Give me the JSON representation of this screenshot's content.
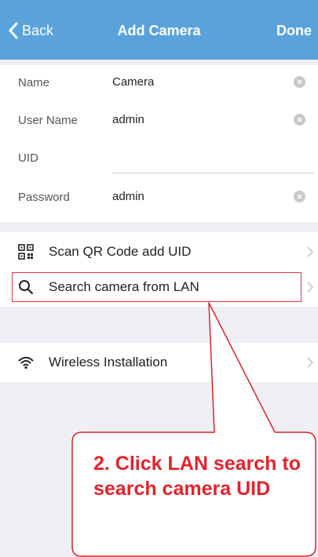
{
  "navbar": {
    "back_label": "Back",
    "title": "Add Camera",
    "done_label": "Done",
    "background": "#5aa2dc"
  },
  "form": {
    "fields": [
      {
        "label": "Name",
        "value": "Camera",
        "clearable": true
      },
      {
        "label": "User Name",
        "value": "admin",
        "clearable": true
      },
      {
        "label": "UID",
        "value": "",
        "clearable": false
      },
      {
        "label": "Password",
        "value": "admin",
        "clearable": true
      }
    ]
  },
  "menu": {
    "scan_qr": {
      "label": "Scan QR Code add UID",
      "icon": "qr-code-icon"
    },
    "search_lan": {
      "label": "Search camera from LAN",
      "icon": "search-icon"
    },
    "wireless": {
      "label": "Wireless Installation",
      "icon": "wifi-icon"
    }
  },
  "annotation": {
    "callout_text": "2. Click LAN search to search camera UID",
    "color": "#e3232b"
  }
}
